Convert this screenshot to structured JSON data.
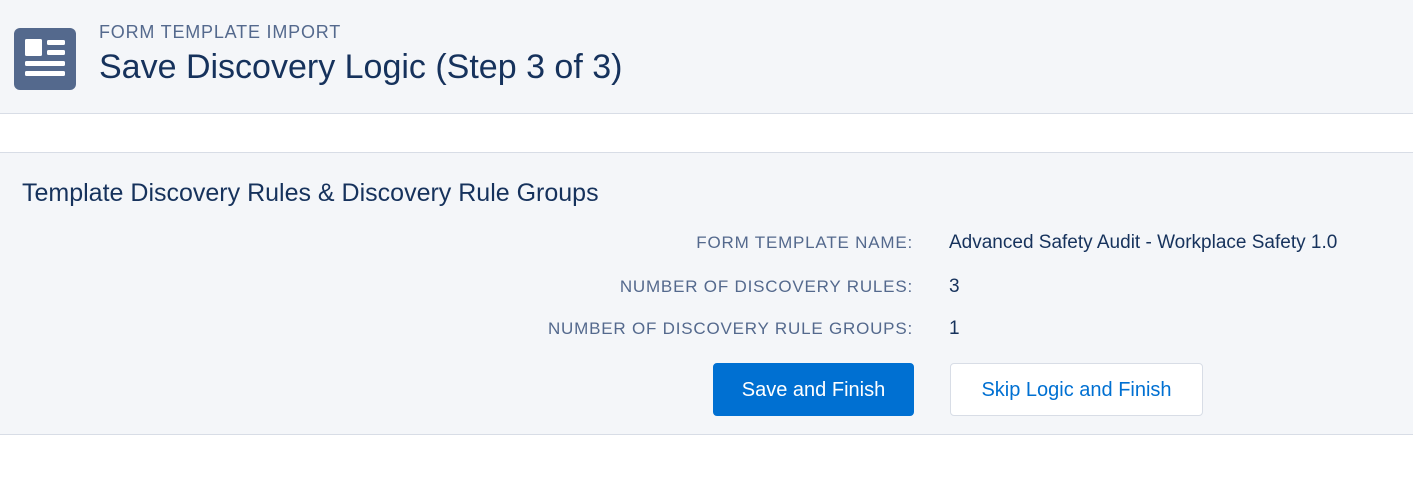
{
  "header": {
    "icon": "form-template-icon",
    "eyebrow": "FORM TEMPLATE IMPORT",
    "title": "Save Discovery Logic (Step 3 of 3)"
  },
  "card": {
    "title": "Template Discovery Rules & Discovery Rule Groups",
    "fields": [
      {
        "label": "FORM TEMPLATE NAME:",
        "value": "Advanced Safety Audit - Workplace Safety 1.0"
      },
      {
        "label": "NUMBER OF DISCOVERY RULES:",
        "value": "3"
      },
      {
        "label": "NUMBER OF DISCOVERY RULE GROUPS:",
        "value": "1"
      }
    ],
    "actions": {
      "primary_label": "Save and Finish",
      "secondary_label": "Skip Logic and Finish"
    }
  },
  "colors": {
    "brand": "#0070d2",
    "header_bg": "#f4f6f9",
    "icon_bg": "#54698d",
    "text": "#16325c",
    "label": "#54698d"
  }
}
